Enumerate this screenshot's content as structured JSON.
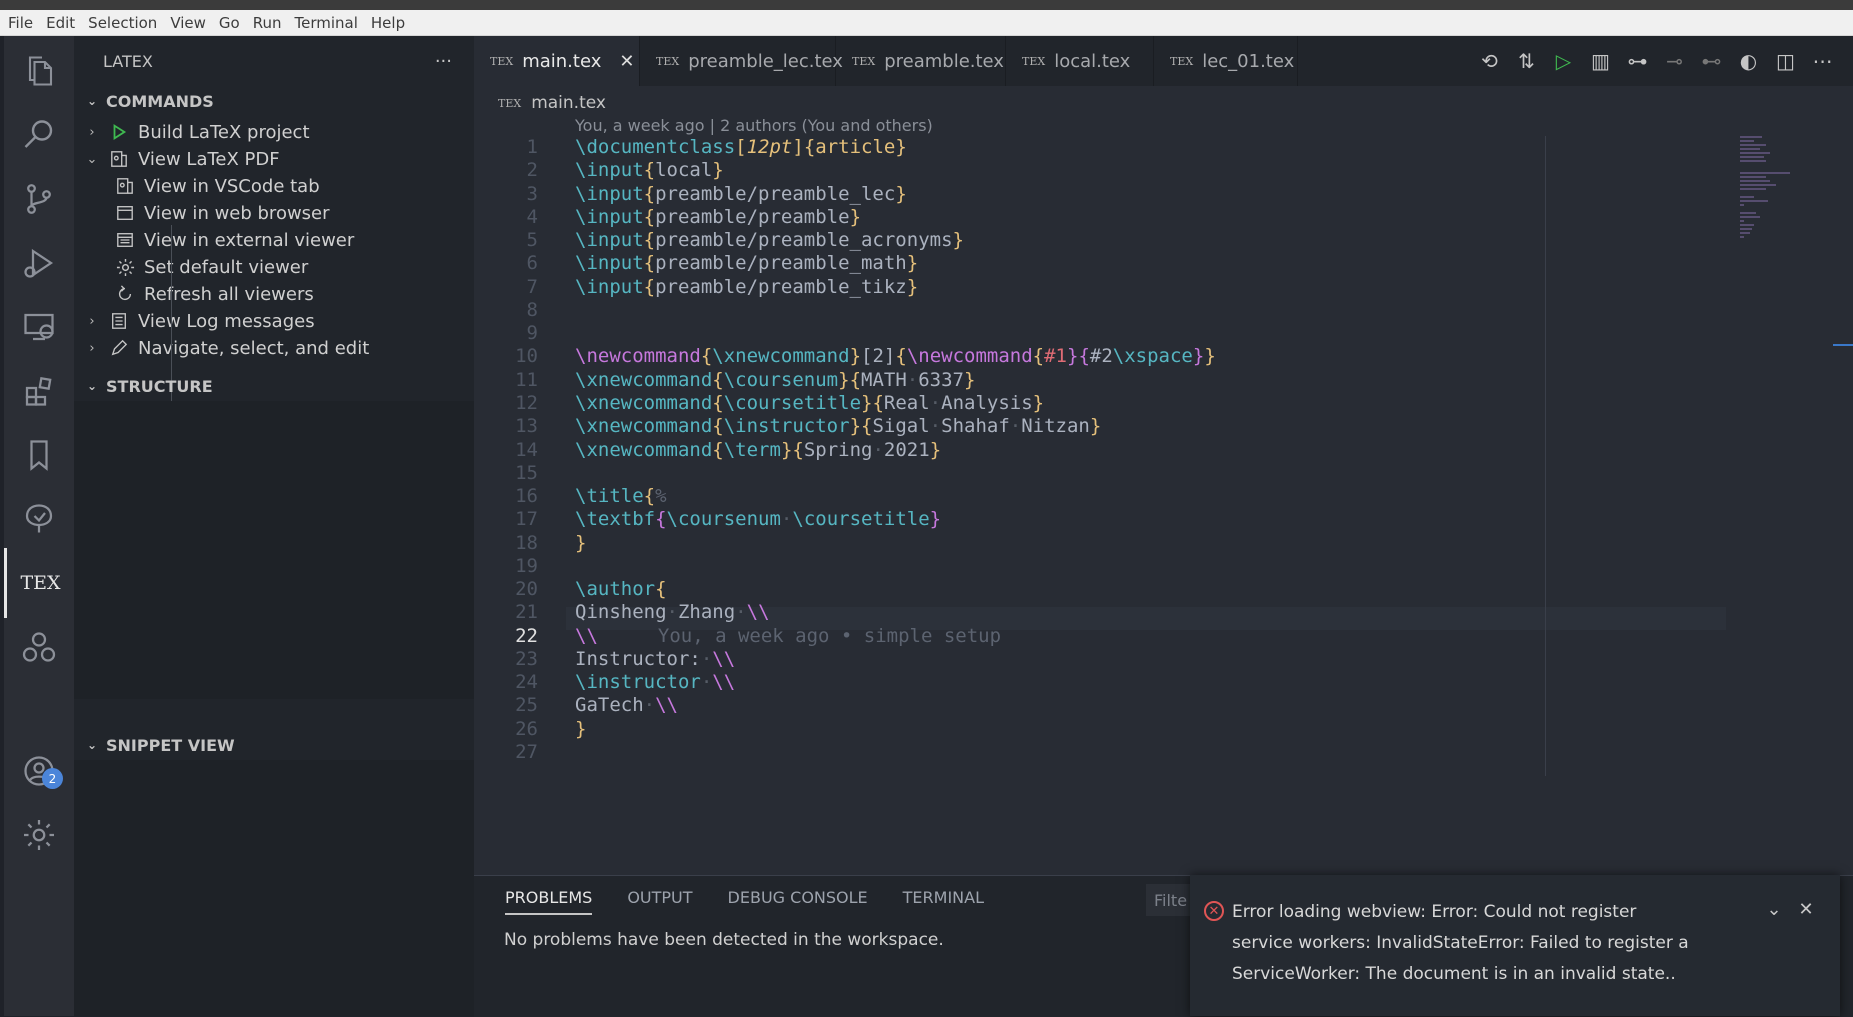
{
  "menu": [
    "File",
    "Edit",
    "Selection",
    "View",
    "Go",
    "Run",
    "Terminal",
    "Help"
  ],
  "activity": {
    "items": [
      "explorer",
      "search",
      "source-control",
      "run-debug",
      "remote-explorer",
      "extensions",
      "bookmarks",
      "tree",
      "tex",
      "gitlens"
    ],
    "accounts_badge": "2"
  },
  "sidebar": {
    "title": "LATEX",
    "more": "···",
    "commands_header": "COMMANDS",
    "commands": [
      {
        "label": "Build LaTeX project",
        "icon": "play-icon",
        "twist": "›",
        "level": 0
      },
      {
        "label": "View LaTeX PDF",
        "icon": "pdf-preview-icon",
        "twist": "⌄",
        "level": 0
      },
      {
        "label": "View in VSCode tab",
        "icon": "pdf-preview-icon",
        "twist": "",
        "level": 1
      },
      {
        "label": "View in web browser",
        "icon": "browser-icon",
        "twist": "",
        "level": 1
      },
      {
        "label": "View in external viewer",
        "icon": "external-window-icon",
        "twist": "",
        "level": 1
      },
      {
        "label": "Set default viewer",
        "icon": "gear-icon",
        "twist": "",
        "level": 1
      },
      {
        "label": "Refresh all viewers",
        "icon": "refresh-icon",
        "twist": "",
        "level": 1
      },
      {
        "label": "View Log messages",
        "icon": "log-icon",
        "twist": "›",
        "level": 0
      },
      {
        "label": "Navigate, select, and edit",
        "icon": "edit-icon",
        "twist": "›",
        "level": 0
      }
    ],
    "structure_header": "STRUCTURE",
    "snippet_header": "SNIPPET VIEW"
  },
  "tabs": [
    {
      "label": "main.tex",
      "active": true
    },
    {
      "label": "preamble_lec.tex",
      "active": false
    },
    {
      "label": "preamble.tex",
      "active": false
    },
    {
      "label": "local.tex",
      "active": false
    },
    {
      "label": "lec_01.tex",
      "active": false
    }
  ],
  "tex_glyph": "TEX",
  "tab_close": "✕",
  "breadcrumb": "main.tex",
  "blame_header": "You, a week ago | 2 authors (You and others)",
  "current_line": 22,
  "inline_blame": "You, a week ago • simple setup",
  "lines": [
    [
      [
        "cmd",
        "\\documentclass"
      ],
      [
        "br",
        "["
      ],
      [
        "opt",
        "12pt"
      ],
      [
        "br",
        "]{"
      ],
      [
        "br",
        "article"
      ],
      [
        "br",
        "}"
      ]
    ],
    [
      [
        "cmd",
        "\\input"
      ],
      [
        "br",
        "{"
      ],
      [
        "pl",
        "local"
      ],
      [
        "br",
        "}"
      ]
    ],
    [
      [
        "cmd",
        "\\input"
      ],
      [
        "br",
        "{"
      ],
      [
        "pl",
        "preamble/preamble_lec"
      ],
      [
        "br",
        "}"
      ]
    ],
    [
      [
        "cmd",
        "\\input"
      ],
      [
        "br",
        "{"
      ],
      [
        "pl",
        "preamble/preamble"
      ],
      [
        "br",
        "}"
      ]
    ],
    [
      [
        "cmd",
        "\\input"
      ],
      [
        "br",
        "{"
      ],
      [
        "pl",
        "preamble/preamble_acronyms"
      ],
      [
        "br",
        "}"
      ]
    ],
    [
      [
        "cmd",
        "\\input"
      ],
      [
        "br",
        "{"
      ],
      [
        "pl",
        "preamble/preamble_math"
      ],
      [
        "br",
        "}"
      ]
    ],
    [
      [
        "cmd",
        "\\input"
      ],
      [
        "br",
        "{"
      ],
      [
        "pl",
        "preamble/preamble_tikz"
      ],
      [
        "br",
        "}"
      ]
    ],
    [],
    [],
    [
      [
        "kw",
        "\\newcommand"
      ],
      [
        "br",
        "{"
      ],
      [
        "cmd",
        "\\xnewcommand"
      ],
      [
        "br",
        "}"
      ],
      [
        "pl",
        "[2]"
      ],
      [
        "br",
        "{"
      ],
      [
        "kw",
        "\\newcommand"
      ],
      [
        "br",
        "{"
      ],
      [
        "arg",
        "#1"
      ],
      [
        "kw",
        "}{"
      ],
      [
        "pl",
        "#2"
      ],
      [
        "cmd",
        "\\xspace"
      ],
      [
        "kw",
        "}"
      ],
      [
        "br",
        "}"
      ]
    ],
    [
      [
        "cmd",
        "\\xnewcommand"
      ],
      [
        "br",
        "{"
      ],
      [
        "cmd",
        "\\coursenum"
      ],
      [
        "br",
        "}{"
      ],
      [
        "pl",
        "MATH"
      ],
      [
        "dot",
        "·"
      ],
      [
        "pl",
        "6337"
      ],
      [
        "br",
        "}"
      ]
    ],
    [
      [
        "cmd",
        "\\xnewcommand"
      ],
      [
        "br",
        "{"
      ],
      [
        "cmd",
        "\\coursetitle"
      ],
      [
        "br",
        "}{"
      ],
      [
        "pl",
        "Real"
      ],
      [
        "dot",
        "·"
      ],
      [
        "pl",
        "Analysis"
      ],
      [
        "br",
        "}"
      ]
    ],
    [
      [
        "cmd",
        "\\xnewcommand"
      ],
      [
        "br",
        "{"
      ],
      [
        "cmd",
        "\\instructor"
      ],
      [
        "br",
        "}{"
      ],
      [
        "pl",
        "Sigal"
      ],
      [
        "dot",
        "·"
      ],
      [
        "pl",
        "Shahaf"
      ],
      [
        "dot",
        "·"
      ],
      [
        "pl",
        "Nitzan"
      ],
      [
        "br",
        "}"
      ]
    ],
    [
      [
        "cmd",
        "\\xnewcommand"
      ],
      [
        "br",
        "{"
      ],
      [
        "cmd",
        "\\term"
      ],
      [
        "br",
        "}{"
      ],
      [
        "pl",
        "Spring"
      ],
      [
        "dot",
        "·"
      ],
      [
        "pl",
        "2021"
      ],
      [
        "br",
        "}"
      ]
    ],
    [],
    [
      [
        "cmd",
        "\\title"
      ],
      [
        "br",
        "{"
      ],
      [
        "gray",
        "%"
      ]
    ],
    [
      [
        "cmd",
        "\\textbf"
      ],
      [
        "kw",
        "{"
      ],
      [
        "cmd",
        "\\coursenum"
      ],
      [
        "dot",
        "·"
      ],
      [
        "cmd",
        "\\coursetitle"
      ],
      [
        "kw",
        "}"
      ]
    ],
    [
      [
        "br",
        "}"
      ]
    ],
    [],
    [
      [
        "cmd",
        "\\author"
      ],
      [
        "br",
        "{"
      ]
    ],
    [
      [
        "pl",
        "Qinsheng"
      ],
      [
        "dot",
        "·"
      ],
      [
        "pl",
        "Zhang"
      ],
      [
        "dot",
        "·"
      ],
      [
        "kw",
        "\\\\"
      ]
    ],
    [
      [
        "kw",
        "\\\\"
      ]
    ],
    [
      [
        "pl",
        "Instructor:"
      ],
      [
        "dot",
        "·"
      ],
      [
        "kw",
        "\\\\"
      ]
    ],
    [
      [
        "cmd",
        "\\instructor"
      ],
      [
        "dot",
        "·"
      ],
      [
        "kw",
        "\\\\"
      ]
    ],
    [
      [
        "pl",
        "GaTech"
      ],
      [
        "dot",
        "·"
      ],
      [
        "kw",
        "\\\\"
      ]
    ],
    [
      [
        "br",
        "}"
      ]
    ],
    []
  ],
  "panel": {
    "tabs": [
      "PROBLEMS",
      "OUTPUT",
      "DEBUG CONSOLE",
      "TERMINAL"
    ],
    "message": "No problems have been detected in the workspace.",
    "filter_placeholder": "Filte"
  },
  "toast": {
    "message": "Error loading webview: Error: Could not register service workers: InvalidStateError: Failed to register a ServiceWorker: The document is in an invalid state..",
    "icon": "error-icon"
  }
}
